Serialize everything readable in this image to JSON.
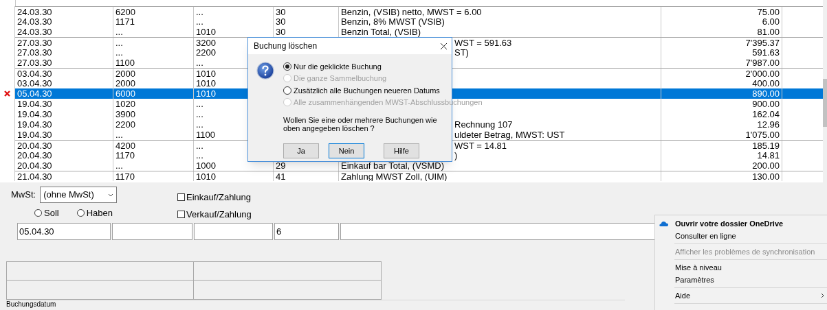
{
  "table": {
    "rows": [
      {
        "date": "24.03.30",
        "col_2": "6200",
        "col_3": "...",
        "col_4": "30",
        "description": {
          "kind": "full",
          "text": "Benzin, (VSIB) netto, MWST = 6.00"
        },
        "amount": "75.00",
        "selected": false,
        "marked": false,
        "separator": true
      },
      {
        "date": "24.03.30",
        "col_2": "1171",
        "col_3": "...",
        "col_4": "30",
        "description": {
          "kind": "full",
          "text": "Benzin, 8% MWST (VSIB)"
        },
        "amount": "6.00",
        "selected": false,
        "marked": false,
        "separator": false
      },
      {
        "date": "24.03.30",
        "col_2": "...",
        "col_3": "1010",
        "col_4": "30",
        "description": {
          "kind": "full",
          "text": "Benzin Total, (VSIB)"
        },
        "amount": "81.00",
        "selected": false,
        "marked": false,
        "separator": false
      },
      {
        "date": "27.03.30",
        "col_2": "...",
        "col_3": "3200",
        "description": {
          "kind": "partial",
          "text": "WST = 591.63"
        },
        "amount": "7'395.37",
        "selected": false,
        "marked": false,
        "separator": true
      },
      {
        "date": "27.03.30",
        "col_2": "...",
        "col_3": "2200",
        "description": {
          "kind": "partial",
          "text": "ST)"
        },
        "amount": "591.63",
        "selected": false,
        "marked": false,
        "separator": false
      },
      {
        "date": "27.03.30",
        "col_2": "1100",
        "col_3": "...",
        "amount": "7'987.00",
        "selected": false,
        "marked": false,
        "separator": false
      },
      {
        "date": "03.04.30",
        "col_2": "2000",
        "col_3": "1010",
        "amount": "2'000.00",
        "selected": false,
        "marked": false,
        "separator": true
      },
      {
        "date": "03.04.30",
        "col_2": "2000",
        "col_3": "1010",
        "amount": "400.00",
        "selected": false,
        "marked": false,
        "separator": false
      },
      {
        "date": "05.04.30",
        "col_2": "6000",
        "col_3": "1010",
        "amount": "890.00",
        "selected": true,
        "marked": true,
        "separator": false
      },
      {
        "date": "19.04.30",
        "col_2": "1020",
        "col_3": "...",
        "amount": "900.00",
        "selected": false,
        "marked": false,
        "separator": false
      },
      {
        "date": "19.04.30",
        "col_2": "3900",
        "col_3": "...",
        "amount": "162.04",
        "selected": false,
        "marked": false,
        "separator": false
      },
      {
        "date": "19.04.30",
        "col_2": "2200",
        "col_3": "...",
        "description": {
          "kind": "partial",
          "text": "Rechnung 107"
        },
        "amount": "12.96",
        "selected": false,
        "marked": false,
        "separator": false
      },
      {
        "date": "19.04.30",
        "col_2": "...",
        "col_3": "1100",
        "description": {
          "kind": "partial",
          "text": "uldeter Betrag, MWST: UST"
        },
        "amount": "1'075.00",
        "selected": false,
        "marked": false,
        "separator": false
      },
      {
        "date": "20.04.30",
        "col_2": "4200",
        "col_3": "...",
        "description": {
          "kind": "partial",
          "text": "WST = 14.81"
        },
        "amount": "185.19",
        "selected": false,
        "marked": false,
        "separator": true
      },
      {
        "date": "20.04.30",
        "col_2": "1170",
        "col_3": "...",
        "description": {
          "kind": "partial",
          "text": ")"
        },
        "amount": "14.81",
        "selected": false,
        "marked": false,
        "separator": false
      },
      {
        "date": "20.04.30",
        "col_2": "...",
        "col_3": "1000",
        "col_4": "29",
        "description": {
          "kind": "full",
          "text": "Einkauf bar Total, (VSMD)"
        },
        "amount": "200.00",
        "selected": false,
        "marked": false,
        "separator": false
      },
      {
        "date": "21.04.30",
        "col_2": "1170",
        "col_3": "1010",
        "col_4": "41",
        "description": {
          "kind": "full",
          "text": "Zahlung MWST Zoll, (UIM)"
        },
        "amount": "130.00",
        "selected": false,
        "marked": false,
        "separator": true
      }
    ]
  },
  "form": {
    "mwst_label": "MwSt:",
    "mwst_value": "(ohne MwSt)",
    "checkboxes": [
      {
        "label": "Einkauf/Zahlung",
        "checked": false
      },
      {
        "label": "Verkauf/Zahlung",
        "checked": false
      }
    ],
    "radios": [
      {
        "label": "Soll",
        "selected": false
      },
      {
        "label": "Haben",
        "selected": false
      }
    ],
    "fields": [
      {
        "kind": "input",
        "value": "05.04.30"
      },
      {
        "kind": "input"
      },
      {
        "kind": "input"
      },
      {
        "kind": "input",
        "value": "6"
      },
      {
        "kind": "input"
      }
    ],
    "status_label": "Buchungsdatum"
  },
  "dialog": {
    "title": "Buchung löschen",
    "options": [
      {
        "label": "Nur die geklickte Buchung",
        "selected": true,
        "disabled": false
      },
      {
        "label": "Die ganze Sammelbuchung",
        "selected": false,
        "disabled": true
      },
      {
        "label": "Zusätzlich alle Buchungen neueren Datums",
        "selected": false,
        "disabled": false
      },
      {
        "label": "Alle zusammenhängenden MWST-Abschlussbuchungen",
        "selected": false,
        "disabled": true
      }
    ],
    "message": "Wollen Sie eine oder mehrere Buchungen wie oben angegeben löschen ?",
    "buttons": [
      {
        "label": "Ja",
        "focused": false
      },
      {
        "label": "Nein",
        "focused": true
      },
      {
        "label": "Hilfe",
        "focused": false
      }
    ]
  },
  "context_menu": {
    "items": [
      {
        "label": "Ouvrir votre dossier OneDrive",
        "kind": "primary",
        "disabled": false
      },
      {
        "label": "Consulter en ligne",
        "kind": "item",
        "disabled": false
      },
      {
        "kind": "separator"
      },
      {
        "label": "Afficher les problèmes de synchronisation",
        "kind": "item",
        "disabled": true
      },
      {
        "kind": "separator"
      },
      {
        "label": "Mise à niveau",
        "kind": "item",
        "disabled": false
      },
      {
        "label": "Paramètres",
        "kind": "item",
        "disabled": false
      },
      {
        "kind": "separator"
      },
      {
        "label": "Aide",
        "kind": "submenu",
        "disabled": false
      },
      {
        "kind": "separator"
      }
    ]
  }
}
